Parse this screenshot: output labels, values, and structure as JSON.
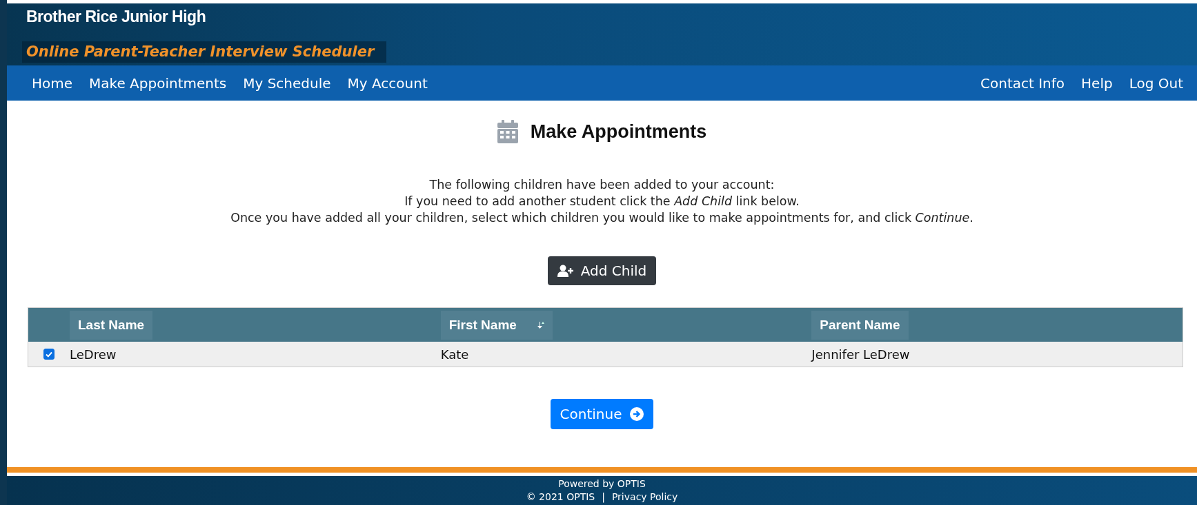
{
  "header": {
    "school": "Brother Rice Junior High",
    "subtitle": "Online Parent-Teacher Interview Scheduler"
  },
  "nav": {
    "left": [
      "Home",
      "Make Appointments",
      "My Schedule",
      "My Account"
    ],
    "right": [
      "Contact Info",
      "Help",
      "Log Out"
    ]
  },
  "page_title": "Make Appointments",
  "instructions": [
    "The following children have been added to your account:",
    "If you need to add another student click the *Add Child* link below.",
    "Once you have added all your children, select which children you would like to make appointments for, and click *Continue*."
  ],
  "add_button": "Add Child",
  "table": {
    "columns": [
      {
        "label": "Last Name",
        "sorted": false
      },
      {
        "label": "First Name",
        "sorted": true
      },
      {
        "label": "Parent Name",
        "sorted": false
      }
    ],
    "rows": [
      {
        "checked": true,
        "cells": [
          "LeDrew",
          "Kate",
          "Jennifer LeDrew"
        ]
      }
    ]
  },
  "continue_button": "Continue",
  "footer": {
    "powered": "Powered by OPTIS",
    "copyright": "© 2021 OPTIS",
    "separator": "|",
    "privacy": "Privacy Policy"
  }
}
